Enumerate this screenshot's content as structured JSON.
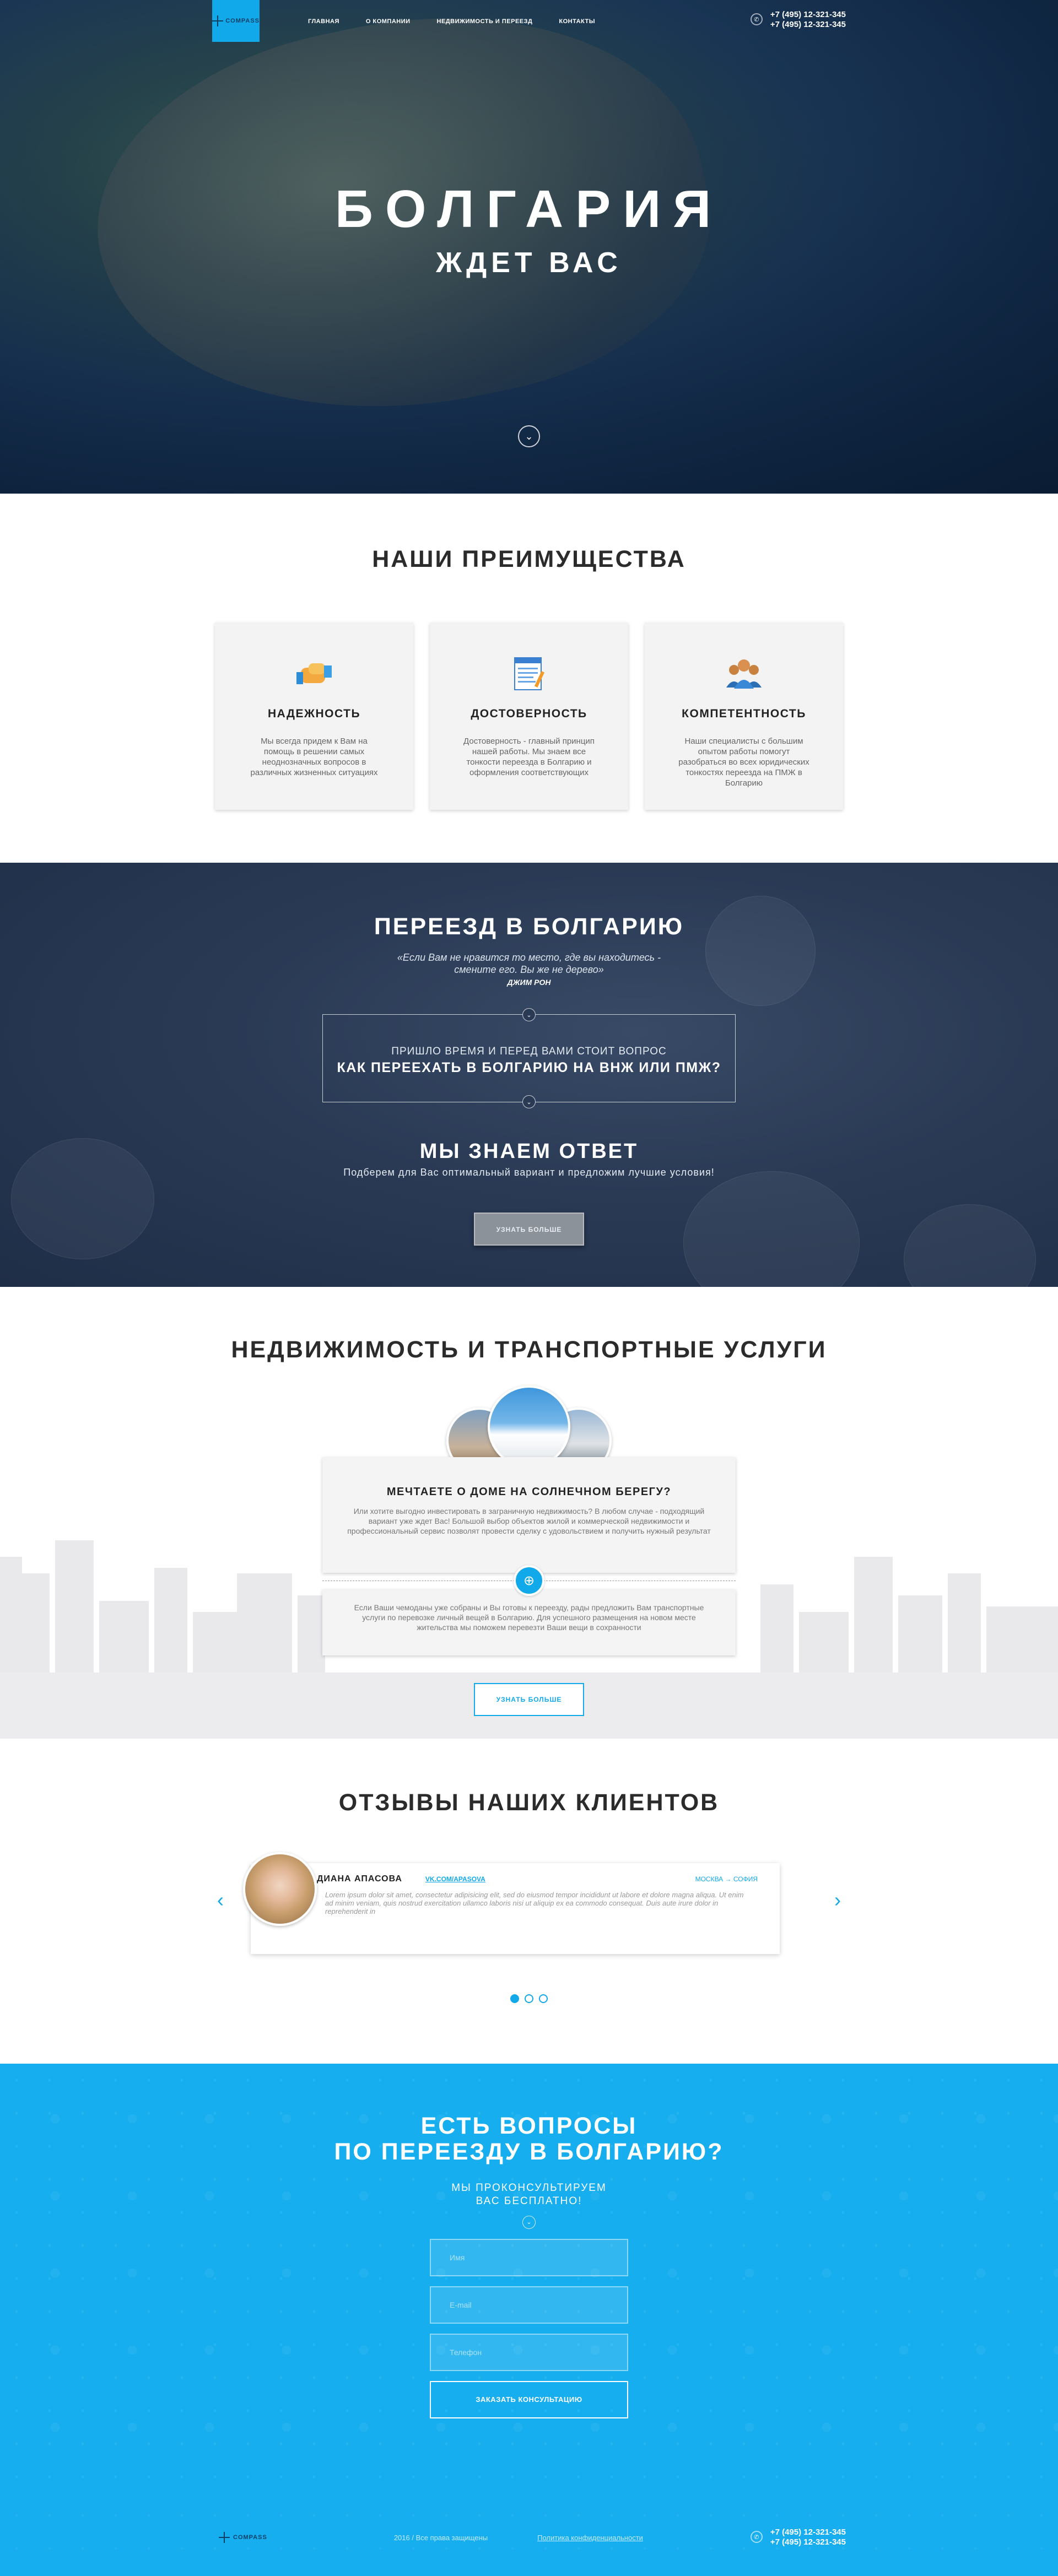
{
  "header": {
    "logo_text": "COMPASS",
    "nav": [
      {
        "label": "ГЛАВНАЯ"
      },
      {
        "label": "О КОМПАНИИ"
      },
      {
        "label": "НЕДВИЖИМОСТЬ И ПЕРЕЕЗД"
      },
      {
        "label": "КОНТАКТЫ"
      }
    ],
    "phones": [
      "+7 (495) 12-321-345",
      "+7 (495) 12-321-345"
    ]
  },
  "hero": {
    "title": "БОЛГАРИЯ",
    "subtitle": "ЖДЕТ ВАС"
  },
  "advantages": {
    "title": "НАШИ ПРЕИМУЩЕСТВА",
    "cards": [
      {
        "title": "НАДЕЖНОСТЬ",
        "text": "Мы всегда придем к Вам на помощь в решении самых неоднозначных вопросов в различных жизненных ситуациях",
        "icon": "handshake-icon"
      },
      {
        "title": "ДОСТОВЕРНОСТЬ",
        "text": "Достоверность - главный принцип нашей работы. Мы знаем все тонкости переезда в Болгарию и оформления соответствующих",
        "icon": "document-icon"
      },
      {
        "title": "КОМПЕТЕНТНОСТЬ",
        "text": "Наши специалисты с большим опытом работы помогут разобраться во всех юридических тонкостях переезда на ПМЖ в Болгарию",
        "icon": "team-icon"
      }
    ]
  },
  "move": {
    "title": "ПЕРЕЕЗД В БОЛГАРИЮ",
    "quote_line1": "«Если Вам не нравится то место, где вы находитесь -",
    "quote_line2": "смените его. Вы же не дерево»",
    "quote_author": "ДЖИМ РОН",
    "question_small": "ПРИШЛО ВРЕМЯ И ПЕРЕД ВАМИ СТОИТ ВОПРОС",
    "question_big": "КАК ПЕРЕЕХАТЬ В БОЛГАРИЮ НА ВНЖ ИЛИ ПМЖ?",
    "answer_title": "МЫ ЗНАЕМ ОТВЕТ",
    "answer_sub": "Подберем для Вас оптимальный вариант и предложим лучшие условия!",
    "button": "УЗНАТЬ БОЛЬШЕ"
  },
  "estate": {
    "title": "НЕДВИЖИМОСТЬ И ТРАНСПОРТНЫЕ УСЛУГИ",
    "card_title": "МЕЧТАЕТЕ О ДОМЕ НА СОЛНЕЧНОМ БЕРЕГУ?",
    "card_text": "Или хотите выгодно инвестировать в заграничную недвижимость? В любом случае - подходящий вариант уже ждет Вас! Большой выбор объектов жилой и коммерческой недвижимости и профессиональный сервис позволят провести сделку с удовольствием и получить нужный результат",
    "card_text2": "Если Ваши чемоданы уже собраны и Вы готовы к переезду, рады предложить Вам транспортные услуги по перевозке личный вещей в Болгарию. Для успешного размещения на новом месте жительства мы поможем перевезти Ваши вещи в сохранности",
    "button": "УЗНАТЬ БОЛЬШЕ"
  },
  "reviews": {
    "title": "ОТЗЫВЫ НАШИХ КЛИЕНТОВ",
    "items": [
      {
        "name": "ДИАНА АПАСОВА",
        "link": "VK.COM/APASOVA",
        "city": "МОСКВА → СОФИЯ",
        "text": "Lorem ipsum dolor sit amet, consectetur adipisicing elit, sed do eiusmod tempor incididunt ut labore et dolore magna aliqua. Ut enim ad minim veniam, quis nostrud exercitation ullamco laboris nisi ut aliquip ex ea commodo consequat. Duis aute irure dolor in reprehenderit in"
      }
    ],
    "pages": 3,
    "active_page": 1
  },
  "contact": {
    "title_line1": "ЕСТЬ ВОПРОСЫ",
    "title_line2": "ПО ПЕРЕЕЗДУ В БОЛГАРИЮ?",
    "sub_line1": "МЫ ПРОКОНСУЛЬТИРУЕМ",
    "sub_line2": "ВАС БЕСПЛАТНО!",
    "fields": [
      {
        "placeholder": "Имя",
        "value": ""
      },
      {
        "placeholder": "E-mail",
        "value": ""
      },
      {
        "placeholder": "Телефон",
        "value": ""
      }
    ],
    "submit": "ЗАКАЗАТЬ КОНСУЛЬТАЦИЮ"
  },
  "footer": {
    "logo_text": "COMPASS",
    "copyright": "2016 / Все права защищены",
    "policy": "Политика конфиденциальности",
    "phones": [
      "+7 (495) 12-321-345",
      "+7 (495) 12-321-345"
    ]
  },
  "colors": {
    "accent": "#12a9ea",
    "contact_bg": "#16aeee",
    "dark_section": "#2a3a55"
  }
}
